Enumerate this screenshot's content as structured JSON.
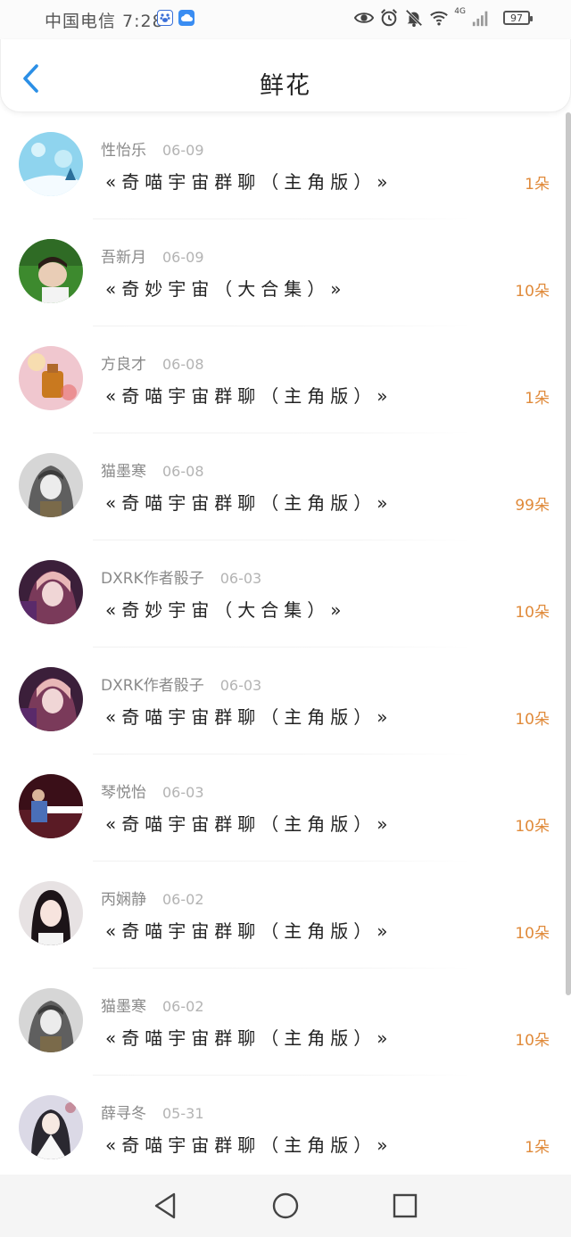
{
  "status_bar": {
    "carrier_time": "中国电信 7:28",
    "network": "4G",
    "battery": "97"
  },
  "header": {
    "title": "鲜花"
  },
  "icons": {
    "back": "chevron-left-icon",
    "eye": "eye-icon",
    "alarm": "alarm-icon",
    "mute": "bell-off-icon",
    "wifi": "wifi-icon",
    "signal": "signal-icon"
  },
  "colors": {
    "accent_blue": "#2b8fe6",
    "count_orange": "#e08a3a",
    "meta_gray": "#8a8a8a"
  },
  "list": {
    "items": [
      {
        "user": "性怡乐",
        "date": "06-09",
        "work": "«奇喵宇宙群聊（主角版）»",
        "count": "1朵",
        "avatar": "snowflake"
      },
      {
        "user": "吾新月",
        "date": "06-09",
        "work": "«奇妙宇宙（大合集）»",
        "count": "10朵",
        "avatar": "boy-grass"
      },
      {
        "user": "方良才",
        "date": "06-08",
        "work": "«奇喵宇宙群聊（主角版）»",
        "count": "1朵",
        "avatar": "perfume"
      },
      {
        "user": "猫墨寒",
        "date": "06-08",
        "work": "«奇喵宇宙群聊（主角版）»",
        "count": "99朵",
        "avatar": "gray-anime"
      },
      {
        "user": "DXRK作者骰子",
        "date": "06-03",
        "work": "«奇妙宇宙（大合集）»",
        "count": "10朵",
        "avatar": "purple-anime"
      },
      {
        "user": "DXRK作者骰子",
        "date": "06-03",
        "work": "«奇喵宇宙群聊（主角版）»",
        "count": "10朵",
        "avatar": "purple-anime"
      },
      {
        "user": "琴悦怡",
        "date": "06-03",
        "work": "«奇喵宇宙群聊（主角版）»",
        "count": "10朵",
        "avatar": "piano"
      },
      {
        "user": "丙娴静",
        "date": "06-02",
        "work": "«奇喵宇宙群聊（主角版）»",
        "count": "10朵",
        "avatar": "girl-photo"
      },
      {
        "user": "猫墨寒",
        "date": "06-02",
        "work": "«奇喵宇宙群聊（主角版）»",
        "count": "10朵",
        "avatar": "gray-anime"
      },
      {
        "user": "薛寻冬",
        "date": "05-31",
        "work": "«奇喵宇宙群聊（主角版）»",
        "count": "1朵",
        "avatar": "white-robe"
      }
    ]
  },
  "nav_bar": {
    "back": "triangle-back-icon",
    "home": "circle-home-icon",
    "recents": "square-recents-icon"
  }
}
